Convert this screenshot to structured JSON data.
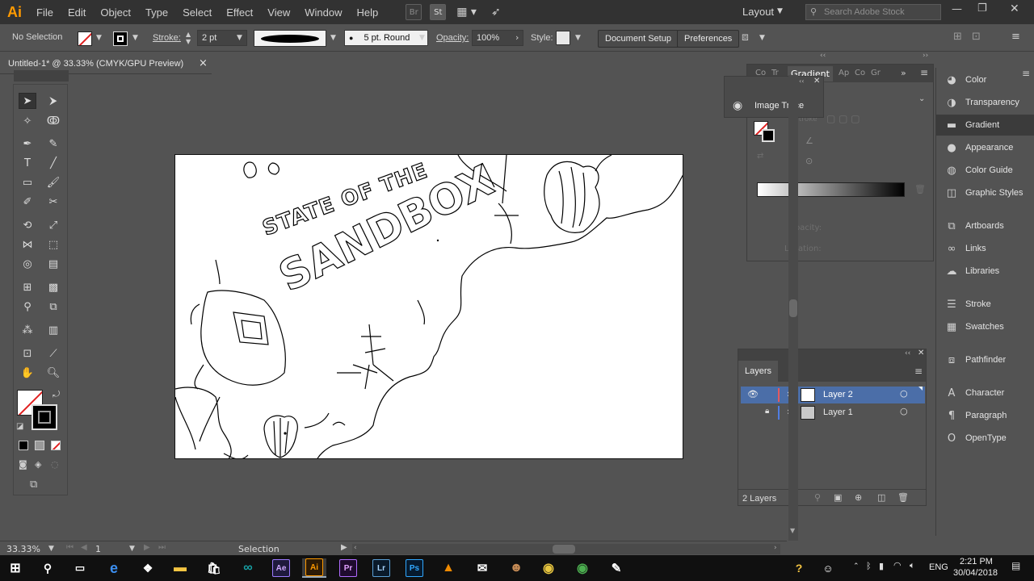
{
  "app": {
    "logo": "Ai",
    "menus": [
      "File",
      "Edit",
      "Object",
      "Type",
      "Select",
      "Effect",
      "View",
      "Window",
      "Help"
    ],
    "mini_icons": [
      "Br",
      "St"
    ],
    "workspace_label": "Layout",
    "search_placeholder": "Search Adobe Stock"
  },
  "control_bar": {
    "selection_label": "No Selection",
    "stroke_label": "Stroke:",
    "stroke_weight": "2 pt",
    "brush_label": "5 pt. Round",
    "opacity_label": "Opacity:",
    "opacity_value": "100%",
    "style_label": "Style:",
    "document_setup": "Document Setup",
    "preferences": "Preferences"
  },
  "document": {
    "tab_title": "Untitled-1* @ 33.33% (CMYK/GPU Preview)",
    "close": "×"
  },
  "gradient_panel": {
    "tabs": [
      "Co",
      "Tr",
      "Gradient",
      "Ap",
      "Co",
      "Gr"
    ],
    "active_tab": "Gradient",
    "stroke_label": "Stroke",
    "opacity_label": "Opacity:",
    "location_label": "Location:",
    "image_trace_label": "Image Trace"
  },
  "layers_panel": {
    "title": "Layers",
    "layers": [
      {
        "name": "Layer 2",
        "color": "#e3595f",
        "visible": true,
        "locked": false,
        "selected": true
      },
      {
        "name": "Layer 1",
        "color": "#4f7de2",
        "visible": false,
        "locked": true,
        "selected": false
      }
    ],
    "footer": "2 Layers"
  },
  "right_dock": {
    "items": [
      {
        "label": "Color",
        "icon": "color-icon"
      },
      {
        "label": "Transparency",
        "icon": "transparency-icon"
      },
      {
        "label": "Gradient",
        "icon": "gradient-icon"
      },
      {
        "label": "Appearance",
        "icon": "appearance-icon"
      },
      {
        "label": "Color Guide",
        "icon": "color-guide-icon"
      },
      {
        "label": "Graphic Styles",
        "icon": "graphic-styles-icon"
      },
      {
        "label": "Artboards",
        "icon": "artboards-icon"
      },
      {
        "label": "Links",
        "icon": "links-icon"
      },
      {
        "label": "Libraries",
        "icon": "libraries-icon"
      },
      {
        "label": "Stroke",
        "icon": "stroke-icon"
      },
      {
        "label": "Swatches",
        "icon": "swatches-icon"
      },
      {
        "label": "Pathfinder",
        "icon": "pathfinder-icon"
      },
      {
        "label": "Character",
        "icon": "character-icon"
      },
      {
        "label": "Paragraph",
        "icon": "paragraph-icon"
      },
      {
        "label": "OpenType",
        "icon": "opentype-icon"
      }
    ]
  },
  "status_bar": {
    "zoom": "33.33%",
    "artboard_number": "1",
    "tool_label": "Selection"
  },
  "taskbar": {
    "apps": [
      "Ae",
      "Ai",
      "Pr",
      "Lr",
      "Ps"
    ],
    "language": "ENG",
    "time": "2:21 PM",
    "date": "30/04/2018"
  },
  "artwork": {
    "title_line1": "STATE OF THE",
    "title_line2": "SANDBOX"
  }
}
